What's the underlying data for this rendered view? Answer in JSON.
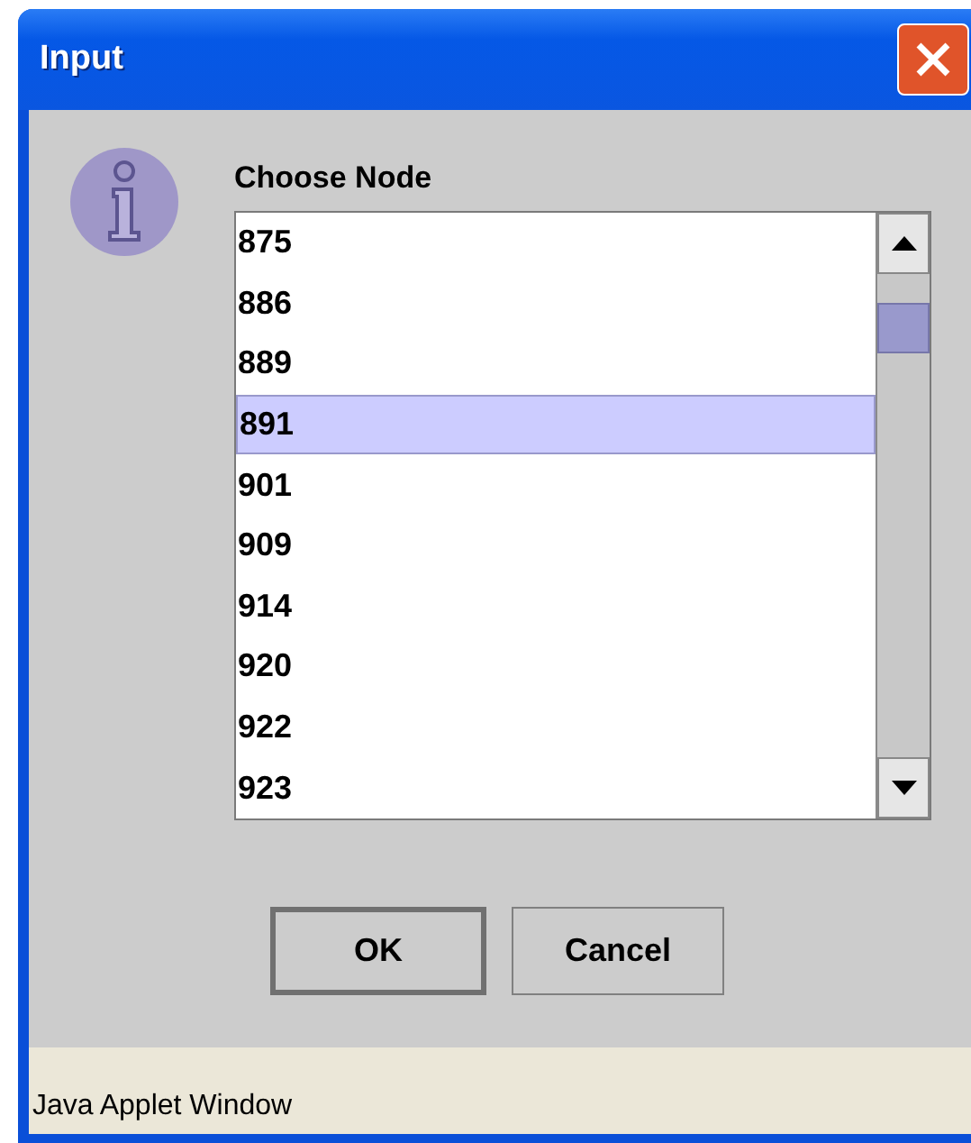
{
  "window": {
    "title": "Input"
  },
  "dialog": {
    "label": "Choose Node",
    "items": [
      {
        "text": "875",
        "selected": false
      },
      {
        "text": "886",
        "selected": false
      },
      {
        "text": "889",
        "selected": false
      },
      {
        "text": "891",
        "selected": true
      },
      {
        "text": "901",
        "selected": false
      },
      {
        "text": "909",
        "selected": false
      },
      {
        "text": "914",
        "selected": false
      },
      {
        "text": "920",
        "selected": false
      },
      {
        "text": "922",
        "selected": false
      },
      {
        "text": "923",
        "selected": false
      }
    ],
    "buttons": [
      {
        "label": "OK",
        "default": true
      },
      {
        "label": "Cancel",
        "default": false
      }
    ]
  },
  "status_bar": {
    "text": "Java Applet Window"
  }
}
